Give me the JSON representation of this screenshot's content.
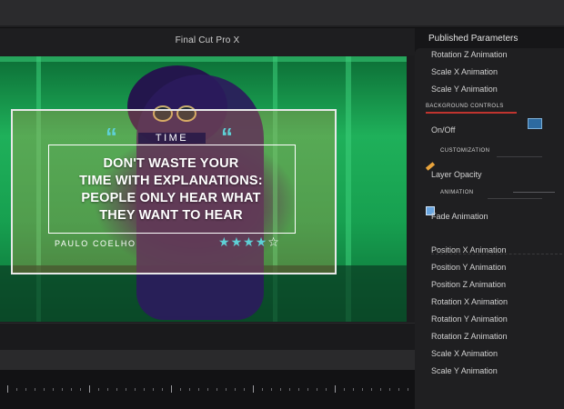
{
  "app": {
    "viewer_title": "Final Cut Pro X"
  },
  "overlay": {
    "tag": "TIME",
    "quote_lines": [
      "DON'T WASTE YOUR",
      "TIME WITH EXPLANATIONS:",
      "PEOPLE ONLY HEAR WHAT",
      "THEY WANT TO HEAR"
    ],
    "author": "PAULO COELHO",
    "rating": {
      "filled": 4,
      "total": 5
    },
    "quote_mark": "“",
    "accent_color": "#5ed0d6"
  },
  "panel": {
    "title": "Published Parameters",
    "top_params": [
      "Rotation Z Animation",
      "Scale X Animation",
      "Scale Y Animation"
    ],
    "section_background": "BACKGROUND CONTROLS",
    "on_off": "On/Off",
    "section_customization": "CUSTOMIZATION",
    "layer_opacity": "Layer Opacity",
    "section_animation": "ANIMATION",
    "fade_animation": "Fade Animation",
    "anim_params": [
      "Position X Animation",
      "Position Y Animation",
      "Position Z Animation",
      "Rotation X Animation",
      "Rotation Y Animation",
      "Rotation Z Animation",
      "Scale X Animation",
      "Scale Y Animation"
    ],
    "section_color": "#c0342f"
  }
}
